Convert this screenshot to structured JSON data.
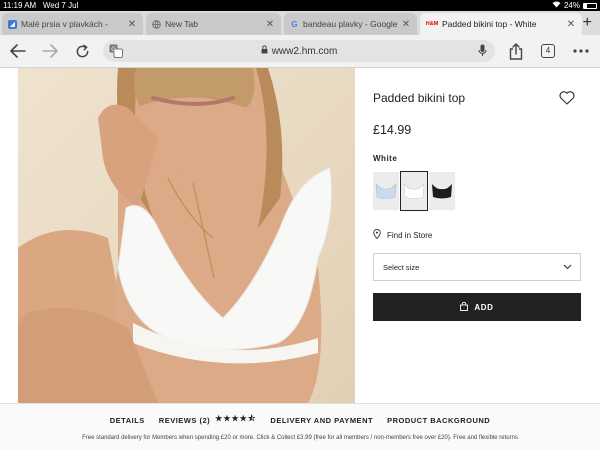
{
  "status_bar": {
    "time": "11:19 AM",
    "date": "Wed 7 Jul",
    "battery": "24%",
    "battery_level": 0.24
  },
  "tabs": [
    {
      "title": "Malé prsia v plavkách - ",
      "favicon": "site-icon",
      "active": false
    },
    {
      "title": "New Tab",
      "favicon": "globe-icon",
      "active": false
    },
    {
      "title": "bandeau plavky - Google",
      "favicon": "google-icon",
      "active": false
    },
    {
      "title": "Padded bikini top - White",
      "favicon": "hm-icon",
      "favicon_text": "H&M",
      "active": true
    }
  ],
  "toolbar": {
    "url": "www2.hm.com",
    "tab_count": "4"
  },
  "product": {
    "title": "Padded bikini top",
    "price": "£14.99",
    "color_label": "White",
    "swatches": [
      {
        "name": "light-blue-variant",
        "color": "#c9dbef"
      },
      {
        "name": "white-variant",
        "color": "#ffffff",
        "selected": true
      },
      {
        "name": "black-variant",
        "color": "#1c1c1c"
      }
    ],
    "find_in_store": "Find in Store",
    "select_size": "Select size",
    "add_label": "ADD"
  },
  "footer": {
    "details": "DETAILS",
    "reviews": "REVIEWS (2)",
    "rating": 4.5,
    "stars": "★★★★⯪",
    "delivery": "DELIVERY AND PAYMENT",
    "background": "PRODUCT BACKGROUND",
    "note": "Free standard delivery for Members when spending £20 or more. Click & Collect £3.99 (free for all members / non-members free over £20). Free and flexible returns"
  },
  "colors": {
    "accent": "#222222",
    "brand": "#e50010",
    "photo_bg": "#e6d8c2"
  }
}
